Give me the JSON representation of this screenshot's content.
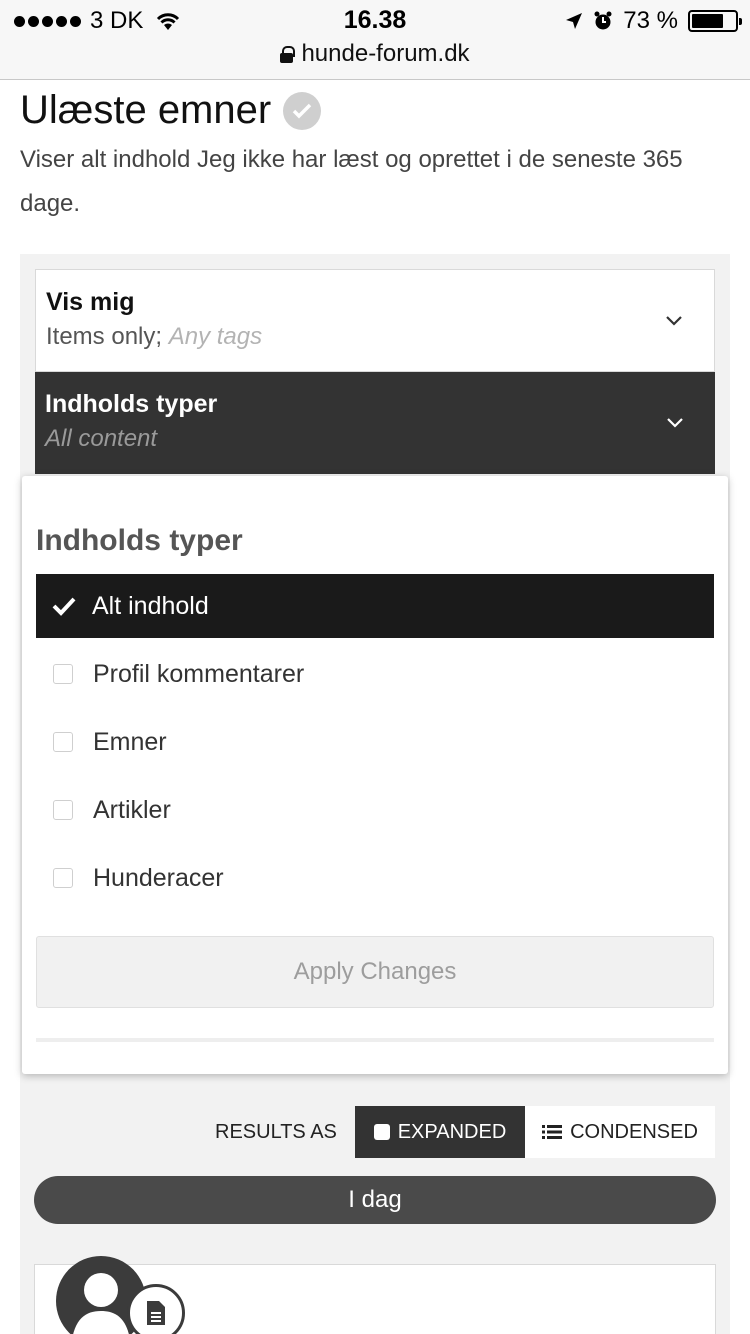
{
  "status": {
    "carrier": "3 DK",
    "time": "16.38",
    "battery": "73 %",
    "battery_level": 0.73,
    "url": "hunde-forum.dk"
  },
  "page": {
    "title": "Ulæste emner",
    "description": "Viser alt indhold Jeg ikke har læst og oprettet i de seneste 365 dage."
  },
  "filters": {
    "show_me": {
      "label": "Vis mig",
      "value": "Items only;",
      "value_muted": "Any tags"
    },
    "content_types": {
      "label": "Indholds typer",
      "value": "All content"
    }
  },
  "dropdown": {
    "title": "Indholds typer",
    "options": [
      {
        "label": "Alt indhold",
        "selected": true
      },
      {
        "label": "Profil kommentarer",
        "selected": false
      },
      {
        "label": "Emner",
        "selected": false
      },
      {
        "label": "Artikler",
        "selected": false
      },
      {
        "label": "Hunderacer",
        "selected": false
      }
    ],
    "apply_label": "Apply Changes"
  },
  "results": {
    "label": "RESULTS AS",
    "expanded": "EXPANDED",
    "condensed": "CONDENSED",
    "active": "expanded"
  },
  "timeline": {
    "group_label": "I dag"
  },
  "colors": {
    "dark": "#333333",
    "selected_option": "#1a1a1a",
    "panel_bg": "#f2f2f2"
  }
}
